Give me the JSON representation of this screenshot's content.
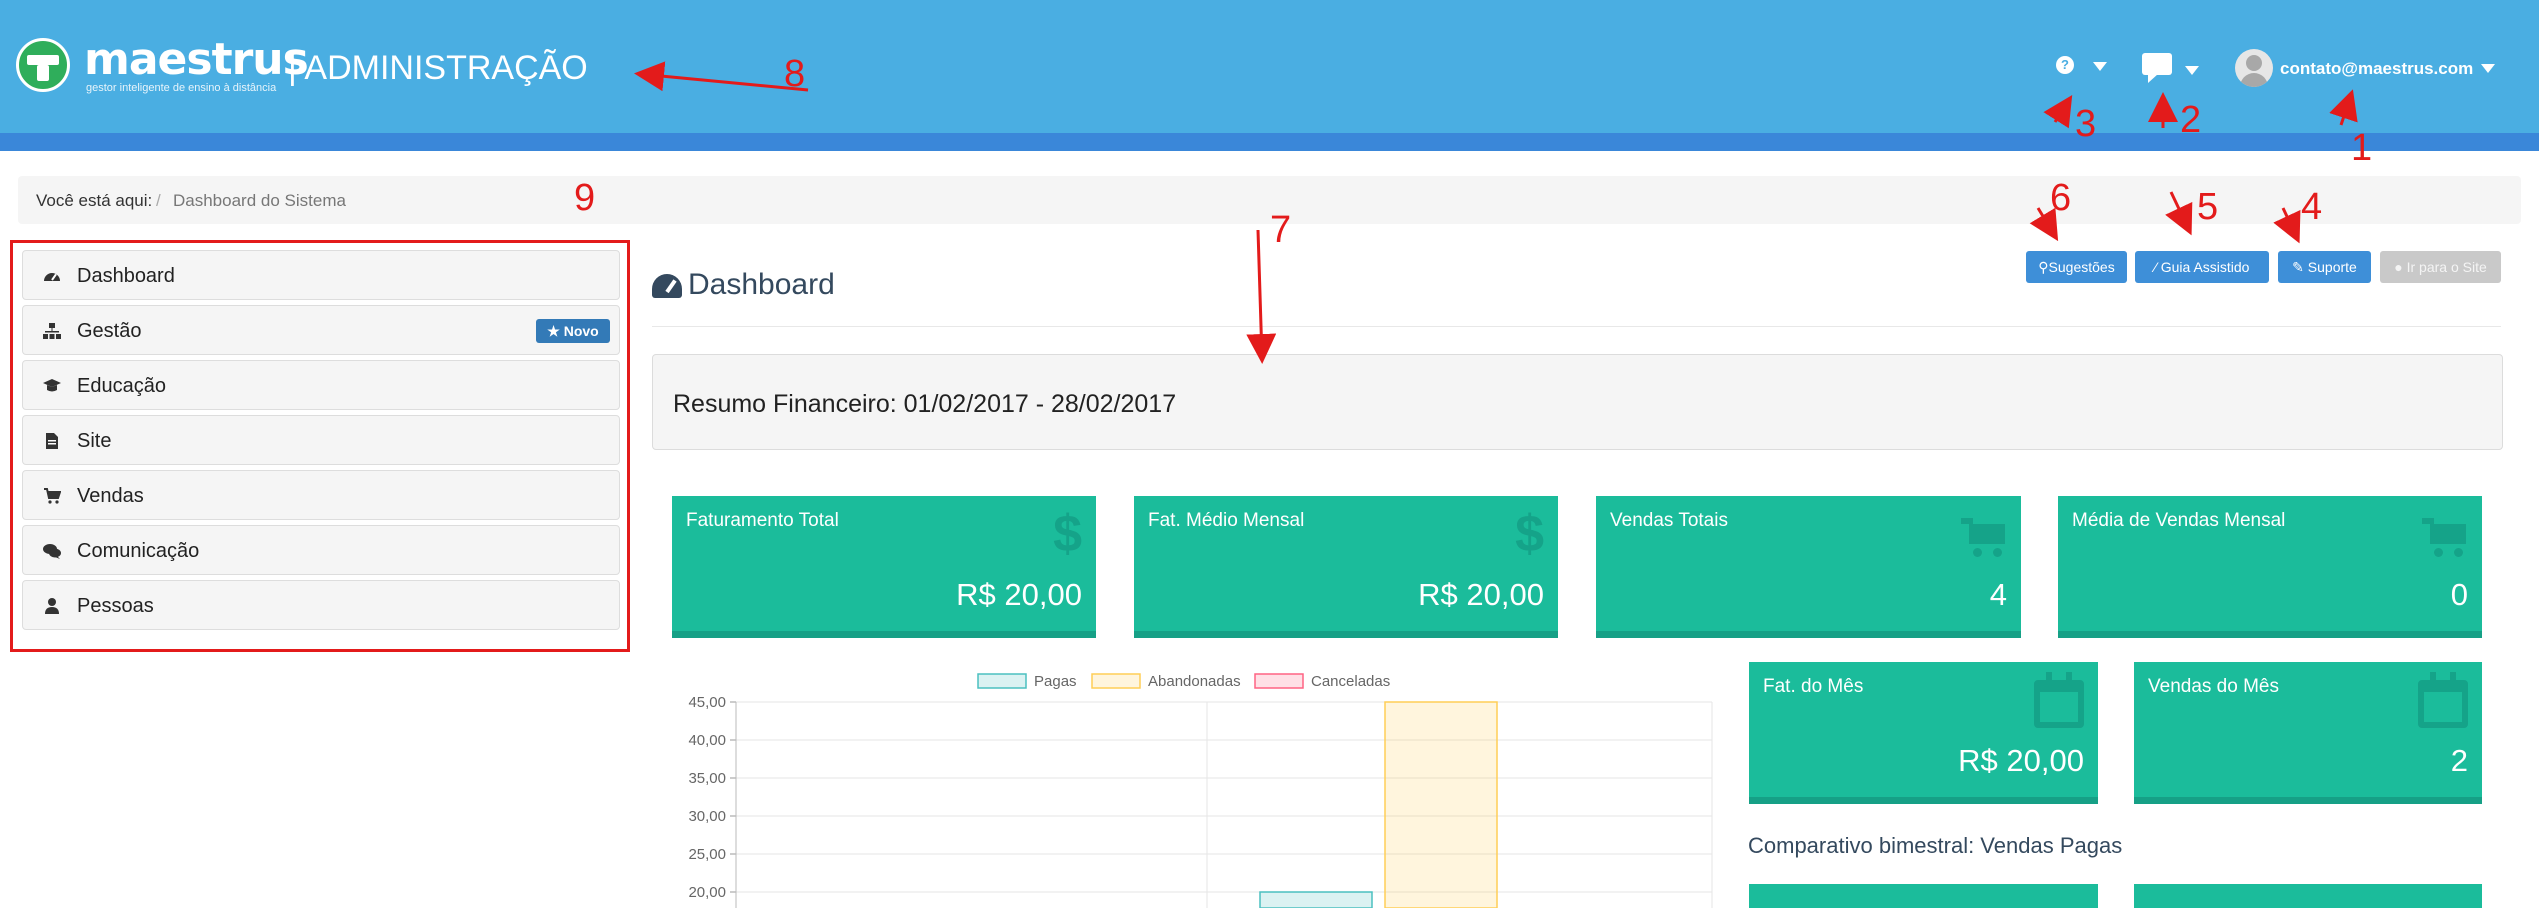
{
  "header": {
    "logo_text": "maestrus",
    "logo_tagline": "gestor inteligente de ensino à distância",
    "admin_title": "| ADMINISTRAÇÃO",
    "user_email": "contato@maestrus.com",
    "colors": {
      "header_bg": "#4aaee2",
      "header_strip": "#3a87d9",
      "accent_teal": "#1bbc9b"
    }
  },
  "icons": {
    "help": "question-circle-icon",
    "chat": "comment-icon",
    "avatar": "user-avatar-icon"
  },
  "breadcrumb": {
    "label": "Você está aqui:",
    "separator": "/",
    "current": "Dashboard do Sistema"
  },
  "sidebar": {
    "items": [
      {
        "label": "Dashboard",
        "icon": "dashboard-icon"
      },
      {
        "label": "Gestão",
        "icon": "sitemap-icon",
        "badge": "Novo"
      },
      {
        "label": "Educação",
        "icon": "graduation-cap-icon"
      },
      {
        "label": "Site",
        "icon": "file-icon"
      },
      {
        "label": "Vendas",
        "icon": "cart-icon"
      },
      {
        "label": "Comunicação",
        "icon": "comments-icon"
      },
      {
        "label": "Pessoas",
        "icon": "user-icon"
      }
    ]
  },
  "main": {
    "title": "Dashboard",
    "toolbar": {
      "suggestions": "Sugestões",
      "guide": "Guia Assistido",
      "support": "Suporte",
      "site": "Ir para o Site"
    },
    "finance_summary": "Resumo Financeiro: 01/02/2017 - 28/02/2017",
    "cards": [
      {
        "label": "Faturamento Total",
        "value": "R$ 20,00",
        "icon": "dollar-icon"
      },
      {
        "label": "Fat. Médio Mensal",
        "value": "R$ 20,00",
        "icon": "dollar-icon"
      },
      {
        "label": "Vendas Totais",
        "value": "4",
        "icon": "cart-icon"
      },
      {
        "label": "Média de Vendas Mensal",
        "value": "0",
        "icon": "cart-icon"
      },
      {
        "label": "Fat. do Mês",
        "value": "R$ 20,00",
        "icon": "calendar-icon"
      },
      {
        "label": "Vendas do Mês",
        "value": "2",
        "icon": "calendar-icon"
      }
    ],
    "compare_title": "Comparativo bimestral: Vendas Pagas"
  },
  "chart_data": {
    "type": "bar",
    "series": [
      {
        "name": "Pagas",
        "color": "#4bc0c0",
        "values": [
          null,
          20
        ]
      },
      {
        "name": "Abandonadas",
        "color": "#ffce56",
        "values": [
          null,
          45
        ]
      },
      {
        "name": "Canceladas",
        "color": "#ff6384",
        "values": [
          null,
          null
        ]
      }
    ],
    "y_ticks": [
      "45,00",
      "40,00",
      "35,00",
      "30,00",
      "25,00",
      "20,00"
    ],
    "ylim": [
      20,
      45
    ],
    "legend": "top",
    "grid": true
  },
  "annotations": {
    "n1": "1",
    "n2": "2",
    "n3": "3",
    "n4": "4",
    "n5": "5",
    "n6": "6",
    "n7": "7",
    "n8": "8",
    "n9": "9"
  }
}
